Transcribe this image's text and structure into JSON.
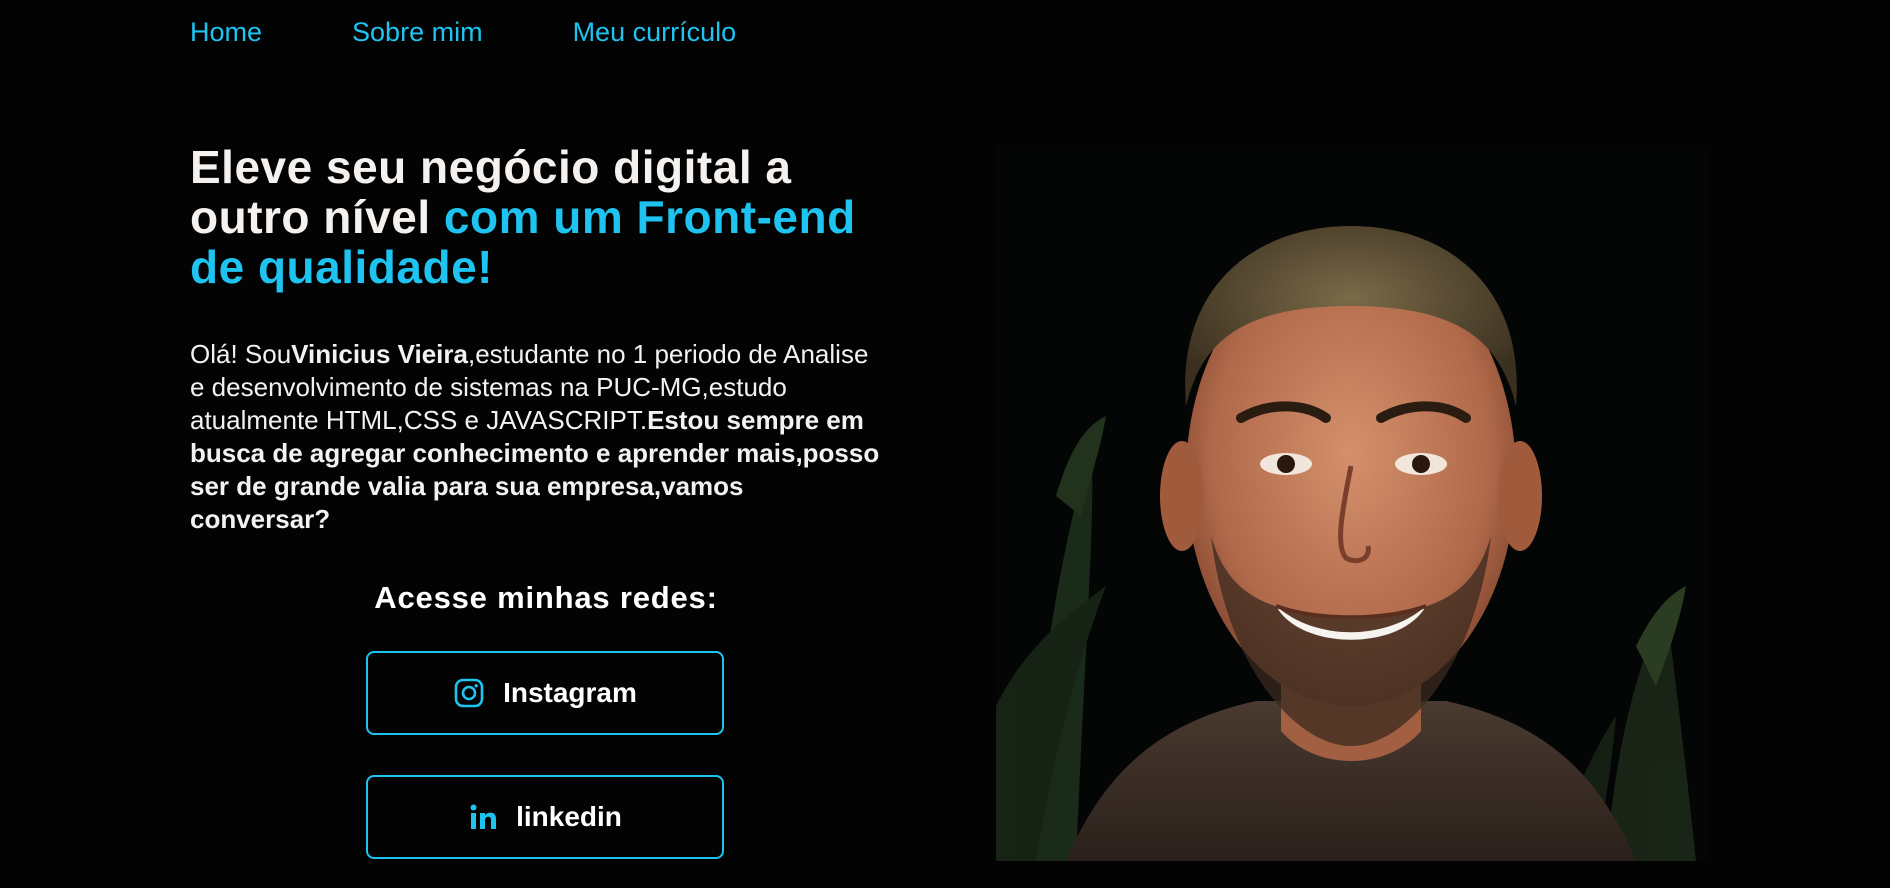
{
  "nav": {
    "items": [
      {
        "label": "Home"
      },
      {
        "label": "Sobre mim"
      },
      {
        "label": "Meu currículo"
      }
    ]
  },
  "hero": {
    "title_part1": "Eleve seu negócio digital a outro nível ",
    "title_accent": "com um Front-end de qualidade!"
  },
  "intro": {
    "greeting": "Olá! Sou",
    "name": "Vinicius Vieira",
    "description": ",estudante no 1 periodo de Analise e desenvolvimento de sistemas na PUC-MG,estudo atualmente HTML,CSS e JAVASCRIPT.",
    "highlight": "Estou sempre em busca de agregar conhecimento e aprender mais,posso ser de grande valia para sua empresa,vamos conversar?"
  },
  "social": {
    "heading": "Acesse minhas redes:",
    "buttons": [
      {
        "label": "Instagram",
        "icon": "instagram-icon"
      },
      {
        "label": "linkedin",
        "icon": "linkedin-icon"
      }
    ]
  },
  "colors": {
    "background": "#030303",
    "accent": "#1ec3f0",
    "text": "#f4f1ee"
  }
}
